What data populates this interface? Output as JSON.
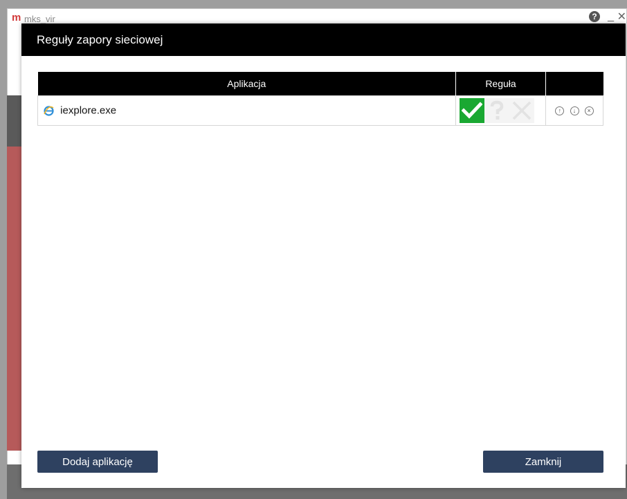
{
  "background_window": {
    "logo": "m",
    "title": "mks_vir",
    "help_glyph": "?",
    "minimize_glyph": "_",
    "close_glyph": "✕"
  },
  "dialog": {
    "title": "Reguły zapory sieciowej",
    "table": {
      "columns": [
        "Aplikacja",
        "Reguła",
        ""
      ],
      "rows": [
        {
          "app_icon": "internet-explorer-icon",
          "app_name": "iexplore.exe",
          "rule_selected": "allow",
          "rule_options": [
            "allow",
            "ask",
            "deny"
          ],
          "actions": [
            "move-up-icon",
            "move-down-icon",
            "remove-icon"
          ]
        }
      ]
    },
    "buttons": {
      "add_label": "Dodaj aplikację",
      "close_label": "Zamknij"
    }
  },
  "colors": {
    "header": "#000000",
    "allow_green": "#1aa832",
    "button_navy": "#2e4160"
  }
}
